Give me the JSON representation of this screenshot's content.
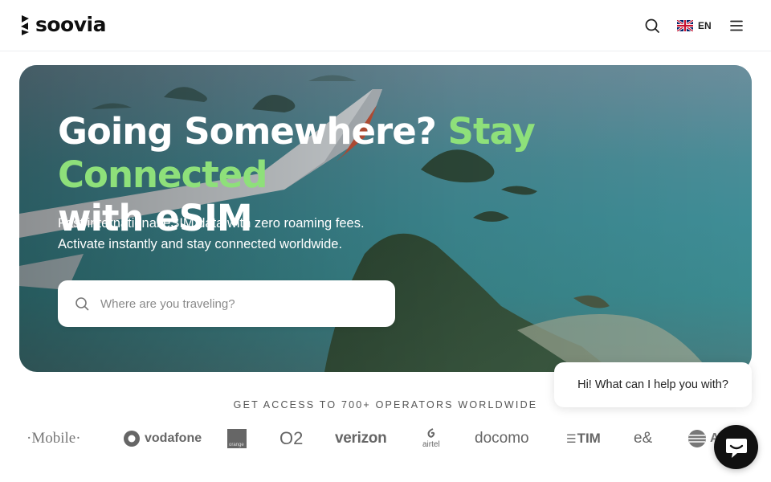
{
  "brand": {
    "name": "soovia"
  },
  "header": {
    "search_icon": "search-icon",
    "language": {
      "flag": "uk-flag-icon",
      "code": "EN"
    },
    "menu_icon": "hamburger-menu-icon"
  },
  "hero": {
    "title_part1": "Going Somewhere? ",
    "title_accent": "Stay Connected",
    "title_part2": "with eSIM",
    "subtitle_line1": "Fast international eSIM data with zero roaming fees.",
    "subtitle_line2": "Activate instantly and stay connected worldwide.",
    "search": {
      "placeholder": "Where are you traveling?",
      "value": ""
    },
    "accent_color": "#8ee07a"
  },
  "operators": {
    "heading": "GET ACCESS TO 700+ OPERATORS WORLDWIDE",
    "logos": [
      "·Mobile·",
      "vodafone",
      "orange",
      "O2",
      "verizon",
      "airtel",
      "docomo",
      "TIM",
      "e&",
      "AT&T"
    ]
  },
  "chat": {
    "greeting": "Hi! What can I help you with?",
    "button_icon": "chat-icon"
  }
}
